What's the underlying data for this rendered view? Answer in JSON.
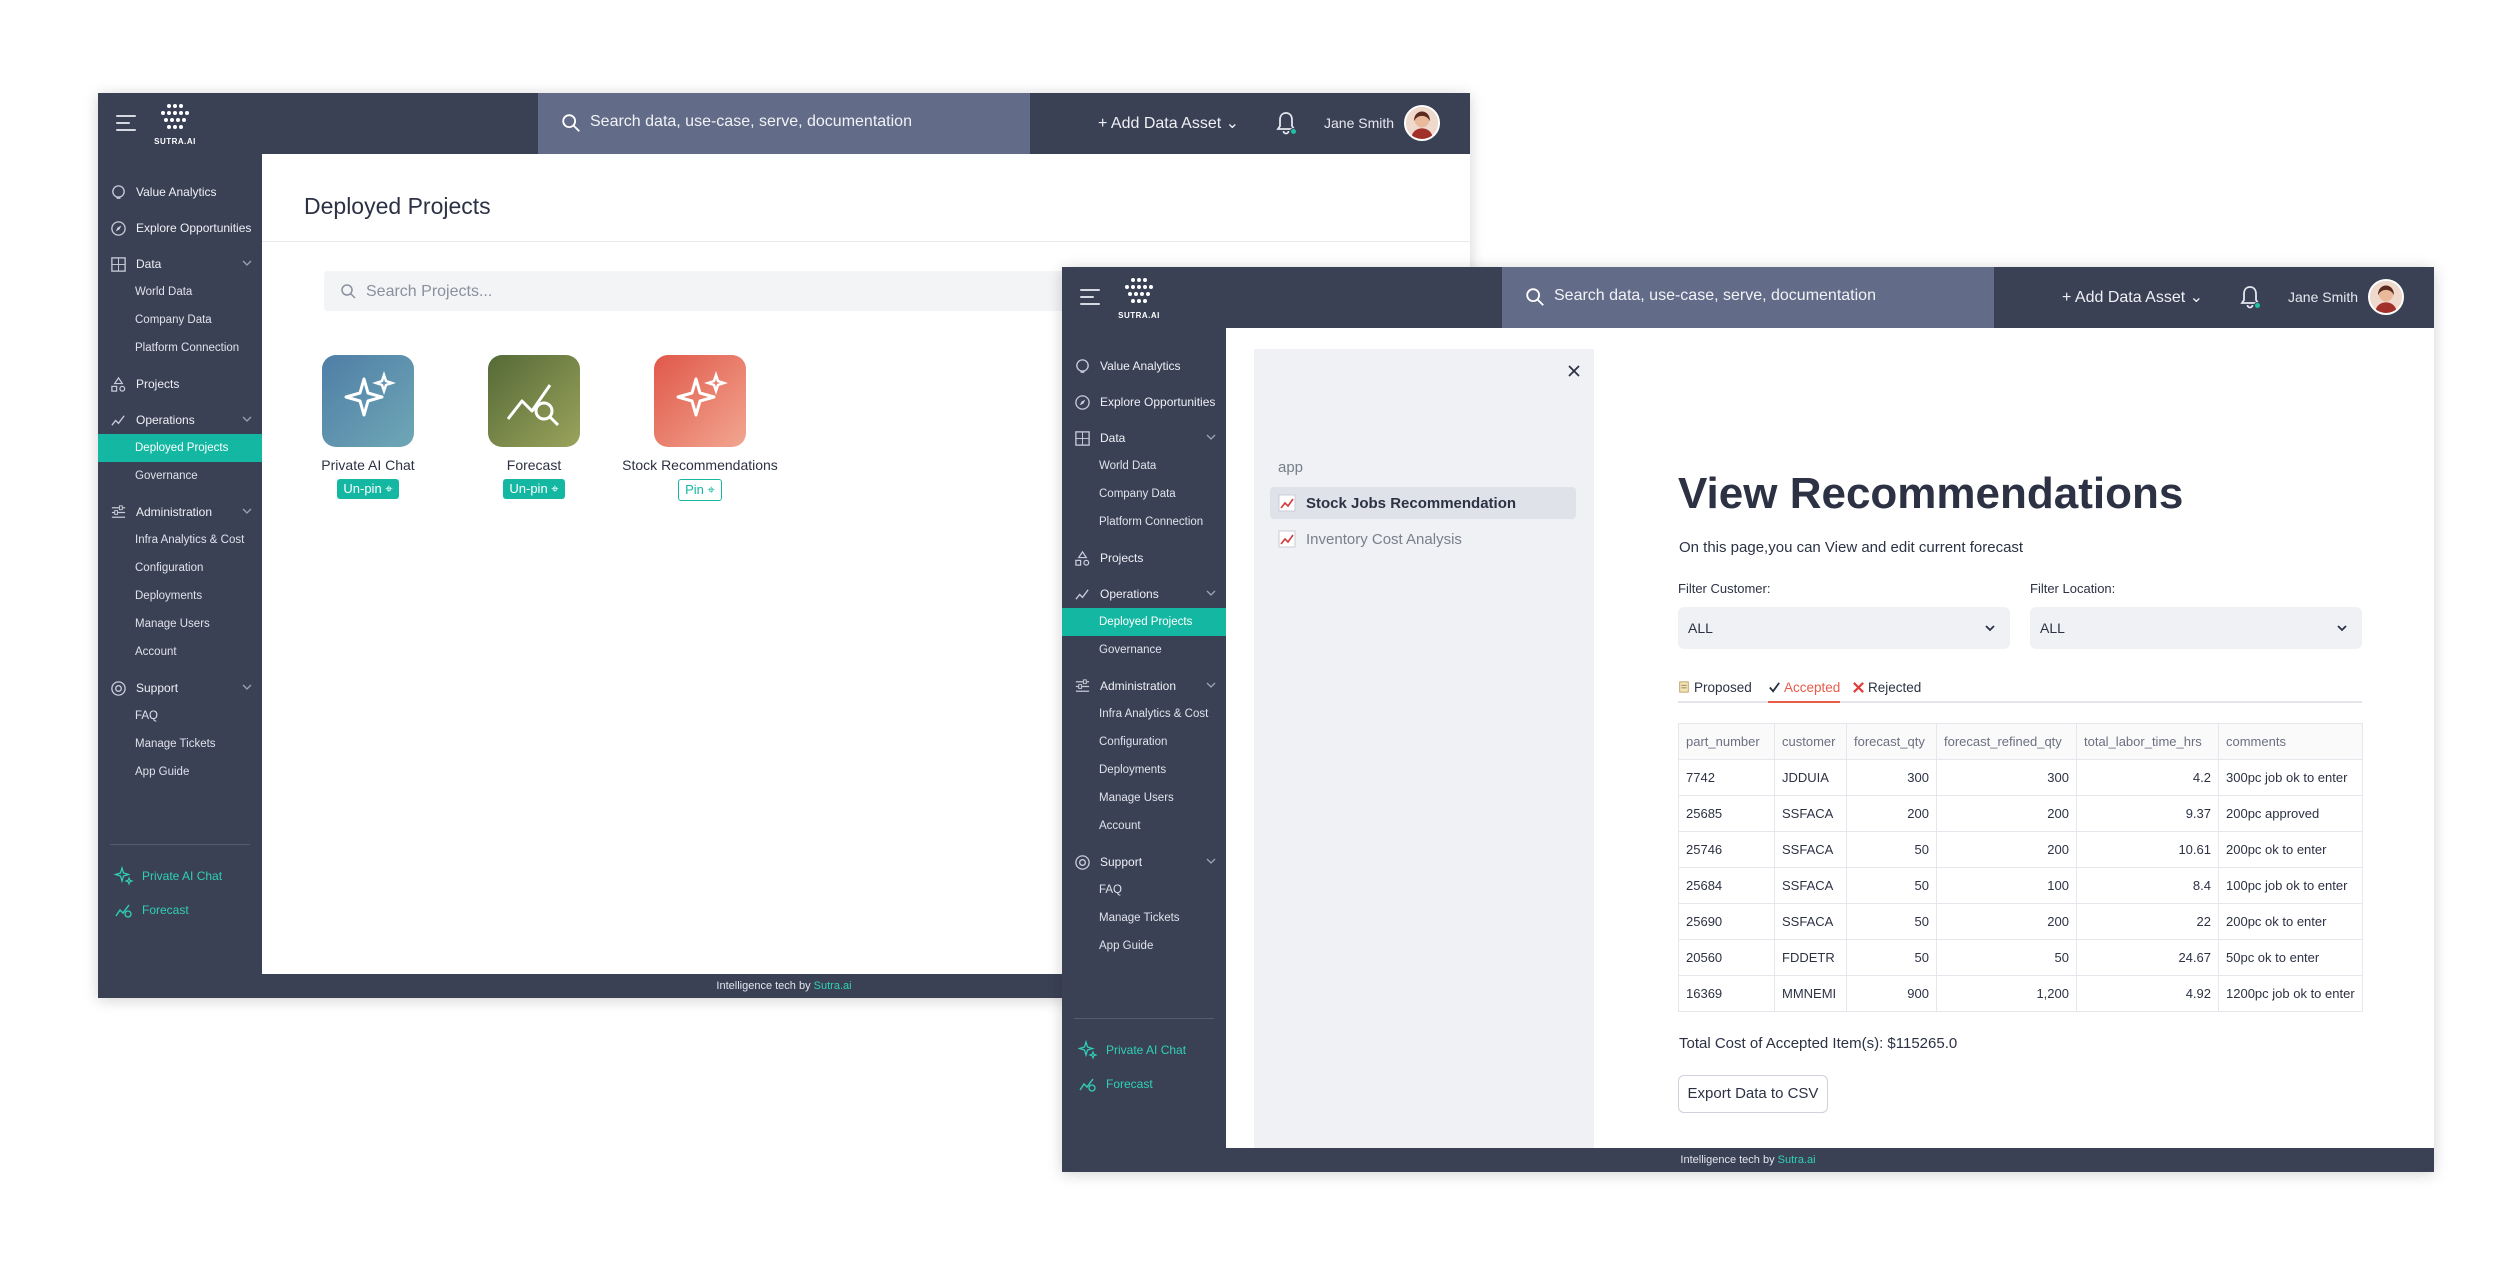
{
  "brand": {
    "logo_text": "SUTRA.AI"
  },
  "topbar": {
    "search_placeholder": "Search data, use-case, serve, documentation",
    "add_data_asset": "Add Data Asset",
    "user_name": "Jane Smith"
  },
  "sidebar": {
    "value_analytics": "Value Analytics",
    "explore": "Explore Opportunities",
    "data": "Data",
    "data_items": [
      "World Data",
      "Company Data",
      "Platform Connection"
    ],
    "projects": "Projects",
    "operations": "Operations",
    "operations_items": [
      "Deployed Projects",
      "Governance"
    ],
    "administration": "Administration",
    "administration_items": [
      "Infra Analytics & Cost",
      "Configuration",
      "Deployments",
      "Manage Users",
      "Account"
    ],
    "support": "Support",
    "support_items": [
      "FAQ",
      "Manage Tickets",
      "App Guide"
    ],
    "pinned": [
      "Private AI Chat",
      "Forecast"
    ]
  },
  "footer": {
    "text": "Intelligence tech by ",
    "brand": "Sutra.ai"
  },
  "deployed": {
    "title": "Deployed Projects",
    "search_placeholder": "Search Projects...",
    "cards": [
      {
        "label": "Private AI Chat",
        "action": "Un-pin"
      },
      {
        "label": "Forecast",
        "action": "Un-pin"
      },
      {
        "label": "Stock Recommendations",
        "action": "Pin"
      }
    ]
  },
  "app": {
    "section_label": "app",
    "pages": [
      "Stock Jobs Recommendation",
      "Inventory Cost Analysis"
    ],
    "title": "View Recommendations",
    "description": "On this page,you can View and edit current forecast",
    "filter_customer_label": "Filter Customer:",
    "filter_customer_value": "ALL",
    "filter_location_label": "Filter Location:",
    "filter_location_value": "ALL",
    "tabs": [
      "Proposed",
      "Accepted",
      "Rejected"
    ],
    "table": {
      "headers": [
        "part_number",
        "customer",
        "forecast_qty",
        "forecast_refined_qty",
        "total_labor_time_hrs",
        "comments"
      ],
      "rows": [
        [
          "7742",
          "JDDUIA",
          "300",
          "300",
          "4.2",
          "300pc job ok to enter"
        ],
        [
          "25685",
          "SSFACA",
          "200",
          "200",
          "9.37",
          "200pc approved"
        ],
        [
          "25746",
          "SSFACA",
          "50",
          "200",
          "10.61",
          "200pc ok to enter"
        ],
        [
          "25684",
          "SSFACA",
          "50",
          "100",
          "8.4",
          "100pc job ok to enter"
        ],
        [
          "25690",
          "SSFACA",
          "50",
          "200",
          "22",
          "200pc ok to enter"
        ],
        [
          "20560",
          "FDDETR",
          "50",
          "50",
          "24.67",
          "50pc ok to enter"
        ],
        [
          "16369",
          "MMNEMI",
          "900",
          "1,200",
          "4.92",
          "1200pc job ok to enter"
        ]
      ]
    },
    "total": "Total Cost of Accepted Item(s): $115265.0",
    "export_label": "Export Data to CSV"
  },
  "colors": {
    "nav_bg": "#3b4155",
    "search_bg": "#626b87",
    "accent": "#14b8a2",
    "tab_active": "#e85c4a"
  }
}
